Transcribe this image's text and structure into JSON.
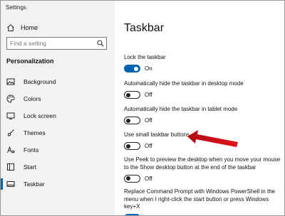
{
  "window": {
    "title": "Settings"
  },
  "sidebar": {
    "home_label": "Home",
    "search_placeholder": "Find a setting",
    "section_title": "Personalization",
    "items": [
      {
        "label": "Background",
        "icon": "picture-icon"
      },
      {
        "label": "Colors",
        "icon": "palette-icon"
      },
      {
        "label": "Lock screen",
        "icon": "lock-screen-icon"
      },
      {
        "label": "Themes",
        "icon": "brush-icon"
      },
      {
        "label": "Fonts",
        "icon": "font-icon"
      },
      {
        "label": "Start",
        "icon": "start-icon"
      },
      {
        "label": "Taskbar",
        "icon": "taskbar-icon",
        "active": true
      }
    ]
  },
  "main": {
    "title": "Taskbar",
    "settings": [
      {
        "label": "Lock the taskbar",
        "state": "On",
        "on": true
      },
      {
        "label": "Automatically hide the taskbar in desktop mode",
        "state": "Off",
        "on": false
      },
      {
        "label": "Automatically hide the taskbar in tablet mode",
        "state": "Off",
        "on": false
      },
      {
        "label": "Use small taskbar buttons",
        "state": "Off",
        "on": false
      },
      {
        "label": "Use Peek to preview the desktop when you move your mouse to the Show desktop button at the end of the taskbar",
        "state": "Off",
        "on": false
      },
      {
        "label": "Replace Command Prompt with Windows PowerShell in the menu when I right-click the start button or press Windows key+X",
        "state": "On",
        "on": true
      }
    ]
  },
  "colors": {
    "accent": "#0063b1",
    "annotation_arrow": "#e3141b",
    "sidebar_bg": "#f2f2f2"
  }
}
